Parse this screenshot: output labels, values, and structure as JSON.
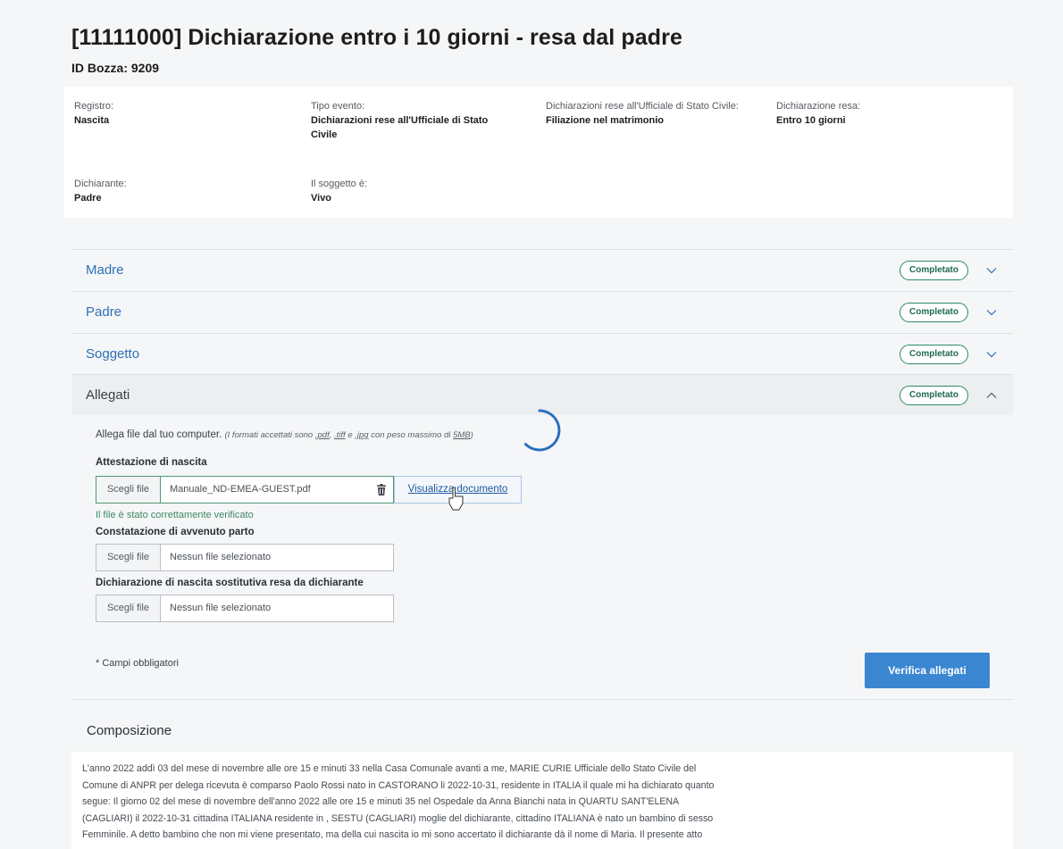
{
  "header": {
    "title": "[11111000] Dichiarazione entro i 10 giorni - resa dal padre",
    "draft_id": "ID Bozza: 9209"
  },
  "info": {
    "registro_label": "Registro:",
    "registro_value": "Nascita",
    "tipo_label": "Tipo evento:",
    "tipo_value_1": "Dichiarazioni rese all'Ufficiale di Stato",
    "tipo_value_2": "Civile",
    "dich_uff_label": "Dichiarazioni rese all'Ufficiale di Stato Civile:",
    "dich_uff_value": "Filiazione nel matrimonio",
    "resa_label": "Dichiarazione resa:",
    "resa_value": "Entro 10 giorni",
    "dichiarante_label": "Dichiarante:",
    "dichiarante_value": "Padre",
    "soggetto_label": "Il soggetto è:",
    "soggetto_value": "Vivo"
  },
  "sections": [
    {
      "title": "Madre",
      "status": "Completato"
    },
    {
      "title": "Padre",
      "status": "Completato"
    },
    {
      "title": "Soggetto",
      "status": "Completato"
    },
    {
      "title": "Allegati",
      "status": "Completato"
    }
  ],
  "attachments": {
    "hint_text": "Allega file dal tuo computer.",
    "hint_italic_1": "(I formati accettati sono",
    "fmt_pdf": ".pdf",
    "fmt_sep": ",",
    "fmt_tiff": ".tiff",
    "hint_e": "e",
    "fmt_jpg": ".jpg",
    "hint_italic_2": "con peso massimo di",
    "max_size": "5MB",
    "hint_close": ")",
    "choose_label": "Scegli file",
    "fields": [
      {
        "label": "Attestazione di nascita",
        "file": "Manuale_ND-EMEA-GUEST.pdf"
      },
      {
        "label": "Constatazione di avvenuto parto",
        "file": "Nessun file selezionato"
      },
      {
        "label": "Dichiarazione di nascita sostitutiva resa da dichiarante",
        "file": "Nessun file selezionato"
      }
    ],
    "view_document": "Visualizza documento",
    "verified_text": "Il file è stato correttamente verificato",
    "required_note": "* Campi obbligatori",
    "verify_button": "Verifica allegati"
  },
  "composition": {
    "title": "Composizione",
    "lines": [
      "L'anno 2022 addì 03 del mese di novembre alle ore 15 e minuti 33 nella Casa Comunale avanti a me, MARIE CURIE Ufficiale dello Stato Civile del",
      "Comune di ANPR per delega ricevuta è comparso Paolo Rossi nato in CASTORANO li 2022-10-31, residente in ITALIA il quale mi ha dichiarato quanto",
      "segue: Il giorno 02 del mese di novembre dell'anno 2022 alle ore 15 e minuti 35 nel Ospedale da Anna Bianchi nata in QUARTU SANT'ELENA",
      "(CAGLIARI) il 2022-10-31 cittadina ITALIANA residente in , SESTU (CAGLIARI) moglie del dichiarante, cittadino ITALIANA è nato un bambino di sesso",
      "Femminile. A detto bambino che non mi viene presentato, ma della cui nascita io mi sono accertato il dichiarante dà il nome di Maria. Il presente atto"
    ]
  },
  "colors": {
    "link_blue": "#2f6fb7",
    "badge_green": "#2d8a66",
    "primary_button": "#3b86d1",
    "spinner": "#2b6fc2"
  }
}
